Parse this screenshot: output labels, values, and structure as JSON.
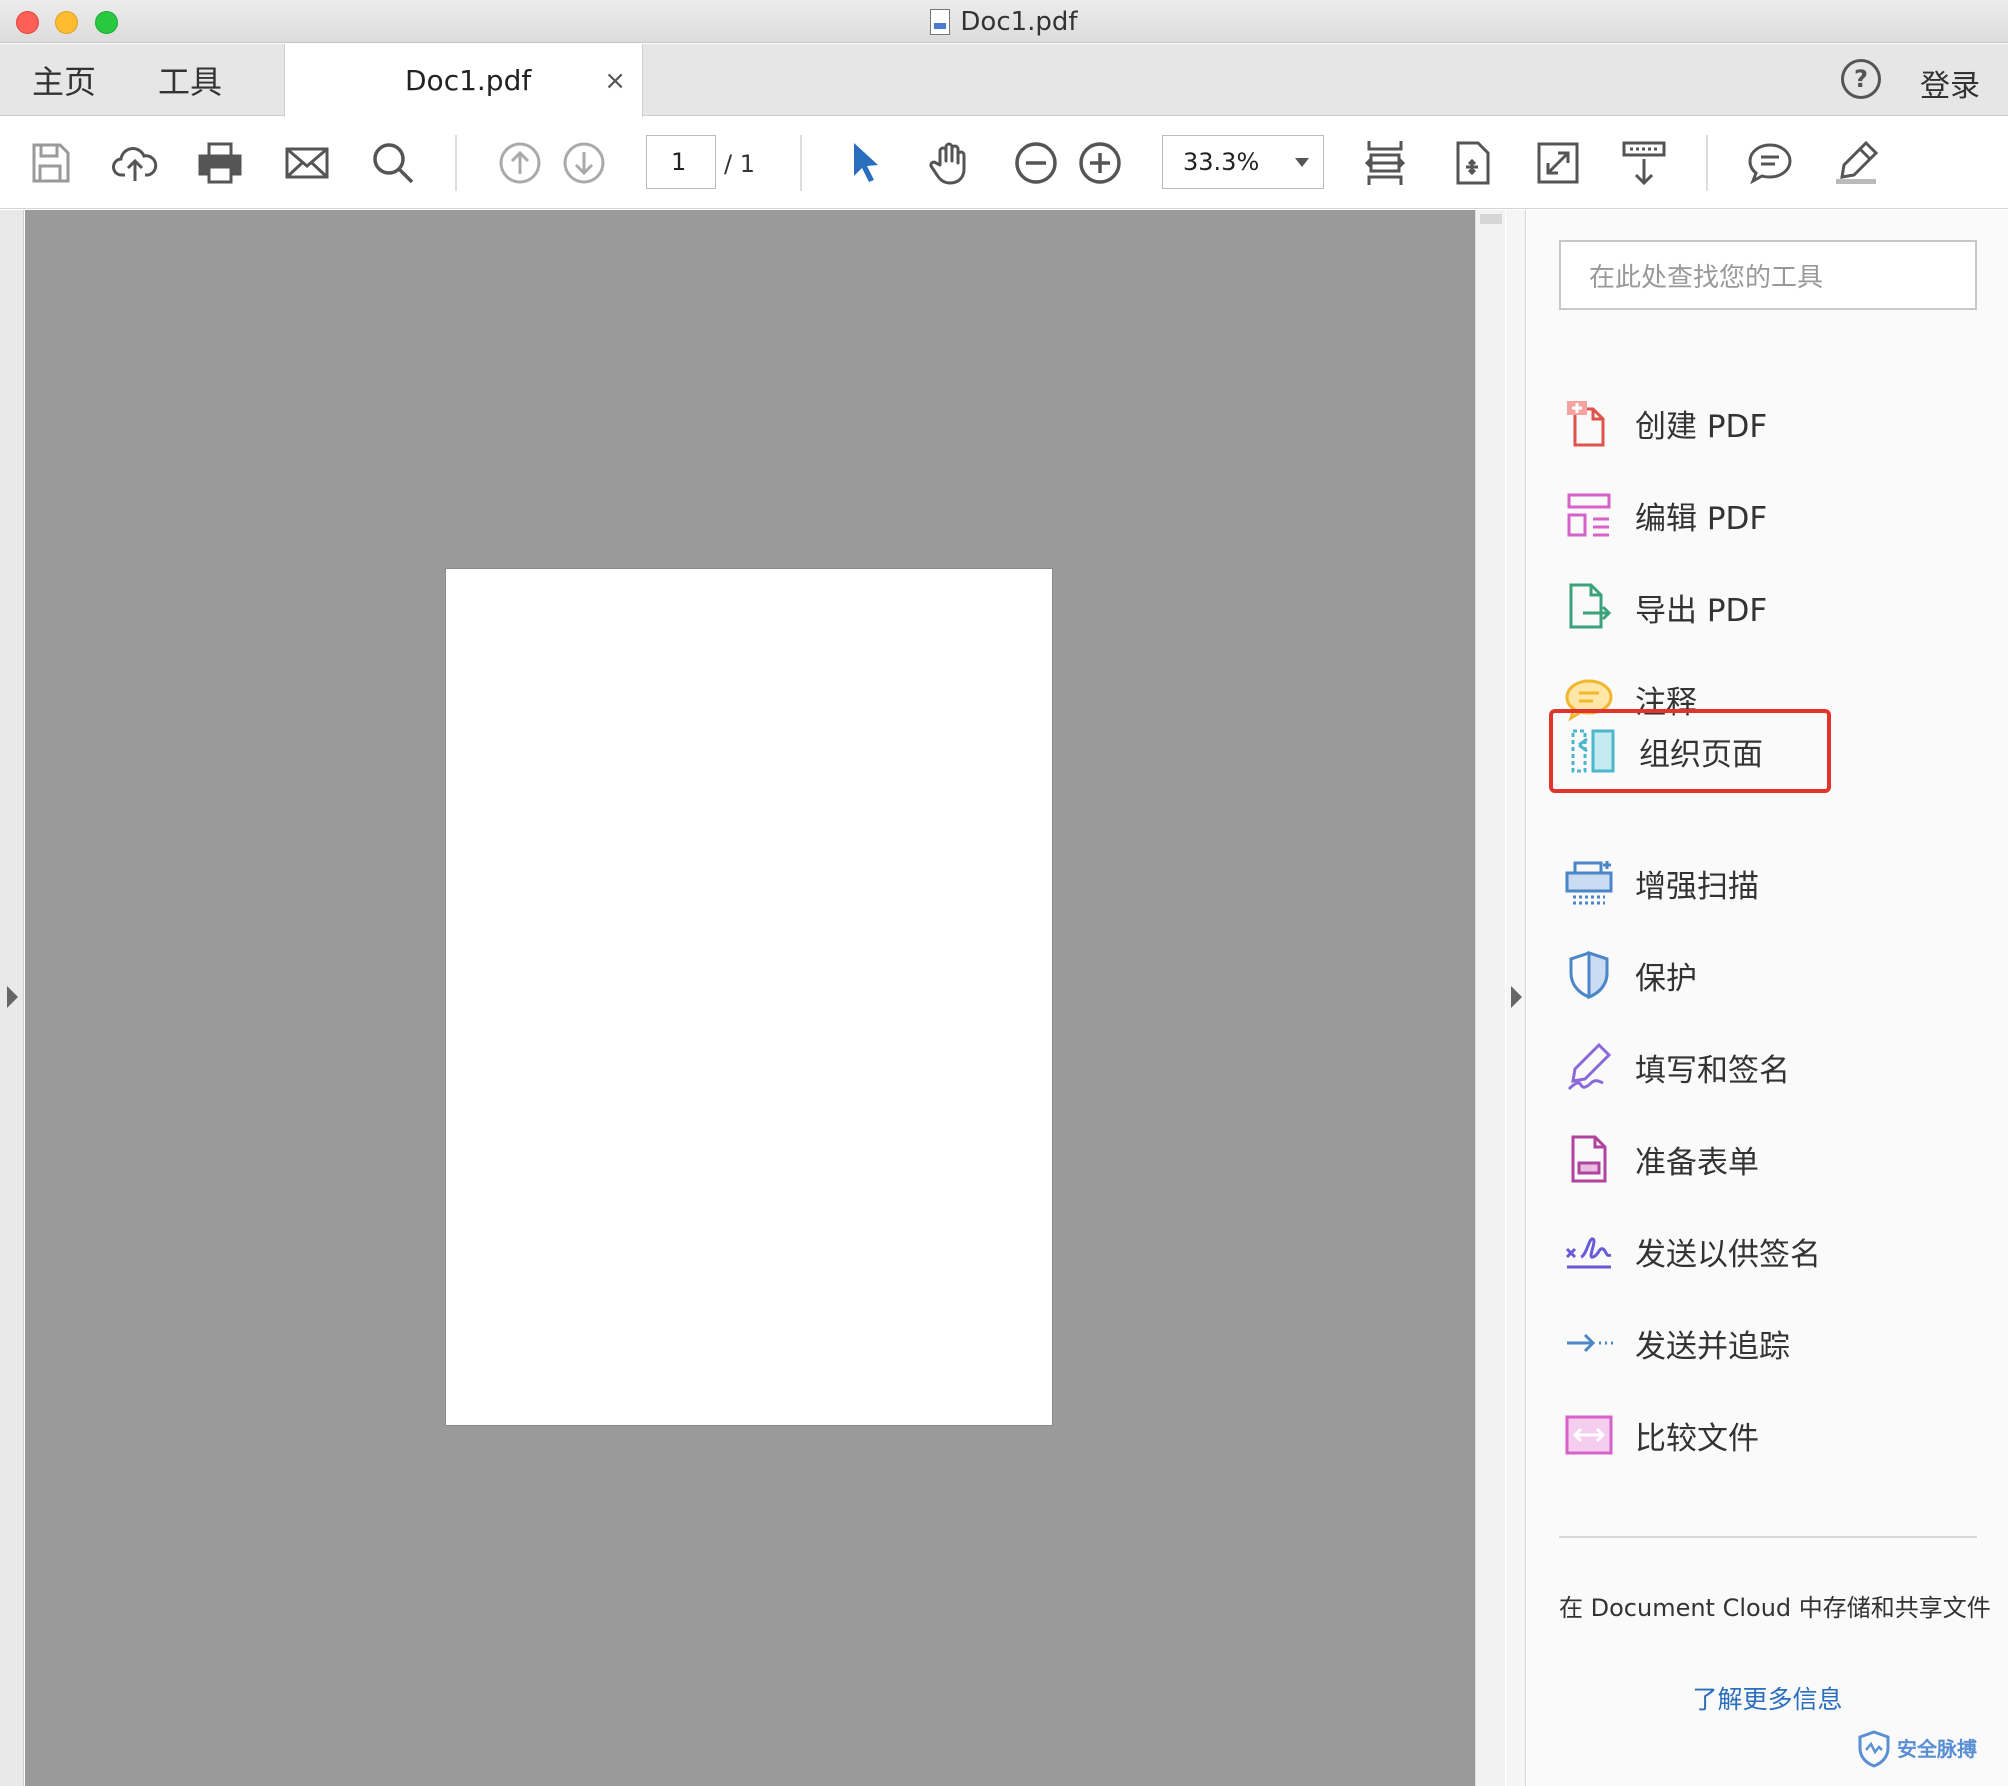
{
  "window": {
    "title": "Doc1.pdf"
  },
  "tabs": {
    "home": "主页",
    "tools": "工具",
    "document": "Doc1.pdf",
    "close": "×",
    "help": "?",
    "login": "登录"
  },
  "toolbar": {
    "icons": [
      "save-icon",
      "upload-cloud-icon",
      "print-icon",
      "email-icon",
      "search-icon",
      "page-up-icon",
      "page-down-icon",
      "select-arrow-icon",
      "hand-icon",
      "zoom-out-icon",
      "zoom-in-icon",
      "fit-page-icon",
      "rotate-icon",
      "fullscreen-icon",
      "scroll-mode-icon",
      "comment-icon",
      "highlight-pen-icon"
    ],
    "page_current": "1",
    "page_total": "/ 1",
    "zoom": "33.3%"
  },
  "pane": {
    "search_placeholder": "在此处查找您的工具",
    "tools": [
      {
        "label": "创建 PDF",
        "icon": "create-pdf-icon",
        "color": "#e0534a"
      },
      {
        "label": "编辑 PDF",
        "icon": "edit-pdf-icon",
        "color": "#d762c9"
      },
      {
        "label": "导出 PDF",
        "icon": "export-pdf-icon",
        "color": "#3ba27b"
      },
      {
        "label": "注释",
        "icon": "comment-tool-icon",
        "color": "#f2b72e"
      },
      {
        "label": "组织页面",
        "icon": "organize-pages-icon",
        "color": "#4bb6cc"
      },
      {
        "label": "增强扫描",
        "icon": "enhance-scan-icon",
        "color": "#4a86c8"
      },
      {
        "label": "保护",
        "icon": "protect-shield-icon",
        "color": "#4a86c8"
      },
      {
        "label": "填写和签名",
        "icon": "fill-sign-icon",
        "color": "#8a6ad8"
      },
      {
        "label": "准备表单",
        "icon": "prepare-form-icon",
        "color": "#b0439f"
      },
      {
        "label": "发送以供签名",
        "icon": "send-signature-icon",
        "color": "#6a5ad8"
      },
      {
        "label": "发送并追踪",
        "icon": "send-track-icon",
        "color": "#4a86c8"
      },
      {
        "label": "比较文件",
        "icon": "compare-files-icon",
        "color": "#d762c9"
      }
    ],
    "active_index": 4,
    "active_border_color": "#e0342c",
    "cloud_text": "在 Document Cloud 中存储和共享文件",
    "learn_more": "了解更多信息",
    "watermark": "安全脉搏"
  }
}
